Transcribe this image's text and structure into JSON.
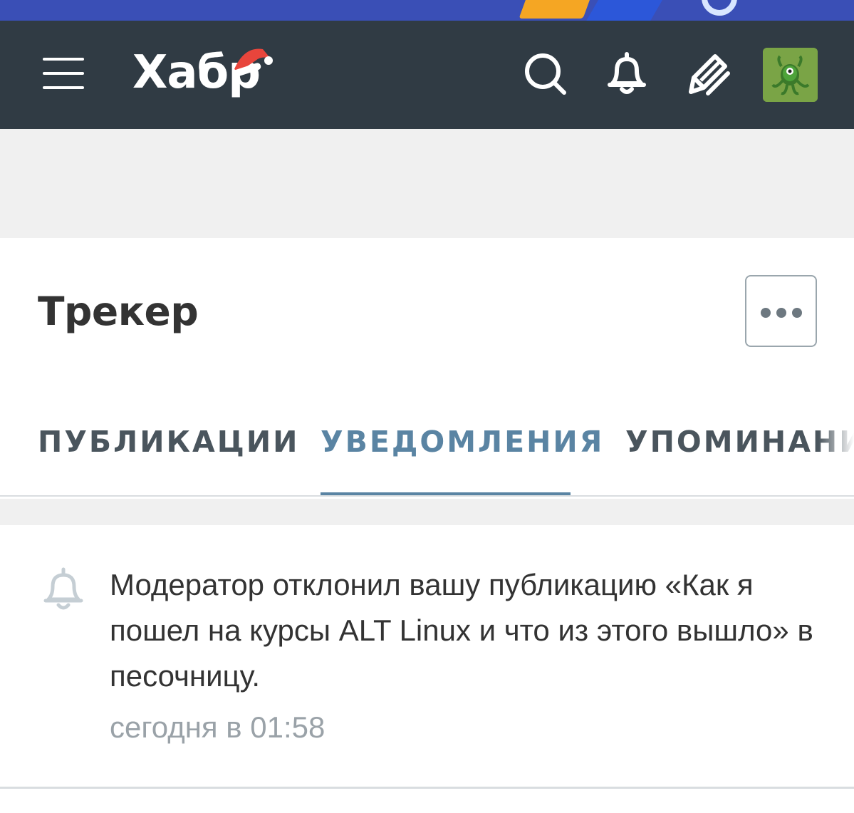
{
  "header": {
    "logo_text": "Хабр",
    "icons": [
      "menu-icon",
      "search-icon",
      "bell-icon",
      "pen-icon",
      "avatar"
    ]
  },
  "page": {
    "title": "Трекер"
  },
  "tabs": [
    {
      "label": "ПУБЛИКАЦИИ",
      "active": false
    },
    {
      "label": "УВЕДОМЛЕНИЯ",
      "active": true
    },
    {
      "label": "УПОМИНАНИЯ",
      "active": false
    }
  ],
  "notifications": [
    {
      "icon": "bell-icon",
      "text": "Модератор отклонил вашу публикацию «Как я пошел на курсы ALT Linux и что из этого вышло» в песочницу.",
      "time": "сегодня в 01:58"
    }
  ],
  "colors": {
    "header_bg": "#303b44",
    "accent": "#5a84a3",
    "text": "#333333",
    "muted": "#9aa2a8"
  }
}
